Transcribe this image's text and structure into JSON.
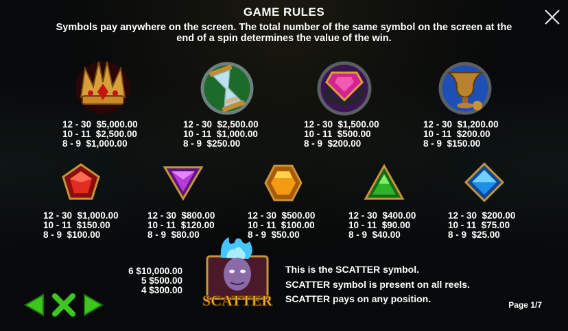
{
  "header": {
    "title": "GAME RULES",
    "description": "Symbols pay anywhere on the screen. The total number of the same symbol on the screen at the end of a spin determines the value of the win."
  },
  "symbols_row1": [
    {
      "icon": "golden-crown-icon",
      "pays": [
        "12 - 30  $5,000.00",
        "10 - 11  $2,500.00",
        "8 - 9  $1,000.00"
      ]
    },
    {
      "icon": "hourglass-icon",
      "pays": [
        "12 - 30  $2,500.00",
        "10 - 11  $1,000.00",
        "8 - 9  $250.00"
      ]
    },
    {
      "icon": "ring-icon",
      "pays": [
        "12 - 30  $1,500.00",
        "10 - 11  $500.00",
        "8 - 9  $200.00"
      ]
    },
    {
      "icon": "chalice-icon",
      "pays": [
        "12 - 30  $1,200.00",
        "10 - 11  $200.00",
        "8 - 9  $150.00"
      ]
    }
  ],
  "symbols_row2": [
    {
      "icon": "red-pentagon-gem-icon",
      "color": "#d8251f",
      "pays": [
        "12 - 30  $1,000.00",
        "10 - 11  $150.00",
        "8 - 9  $100.00"
      ]
    },
    {
      "icon": "purple-triangle-gem-icon",
      "color": "#b33bd6",
      "pays": [
        "12 - 30  $800.00",
        "10 - 11  $120.00",
        "8 - 9  $80.00"
      ]
    },
    {
      "icon": "orange-hexagon-gem-icon",
      "color": "#f19a12",
      "pays": [
        "12 - 30  $500.00",
        "10 - 11  $100.00",
        "8 - 9  $50.00"
      ]
    },
    {
      "icon": "green-triangle-gem-icon",
      "color": "#2db52a",
      "pays": [
        "12 - 30  $400.00",
        "10 - 11  $90.00",
        "8 - 9  $40.00"
      ]
    },
    {
      "icon": "blue-diamond-gem-icon",
      "color": "#1f8fe8",
      "pays": [
        "12 - 30  $200.00",
        "10 - 11  $75.00",
        "8 - 9  $25.00"
      ]
    }
  ],
  "scatter": {
    "icon": "scatter-icon",
    "logo_text": "SCATTER",
    "pays": [
      "6  $10,000.00",
      "5  $500.00",
      "4  $300.00"
    ],
    "info": [
      "This is the SCATTER symbol.",
      "SCATTER symbol is present on all reels.",
      "SCATTER pays on any position."
    ]
  },
  "footer": {
    "page": "Page 1/7"
  },
  "colors": {
    "nav_green": "#3cc61e",
    "background": "#07090a",
    "text": "#ffffff"
  }
}
